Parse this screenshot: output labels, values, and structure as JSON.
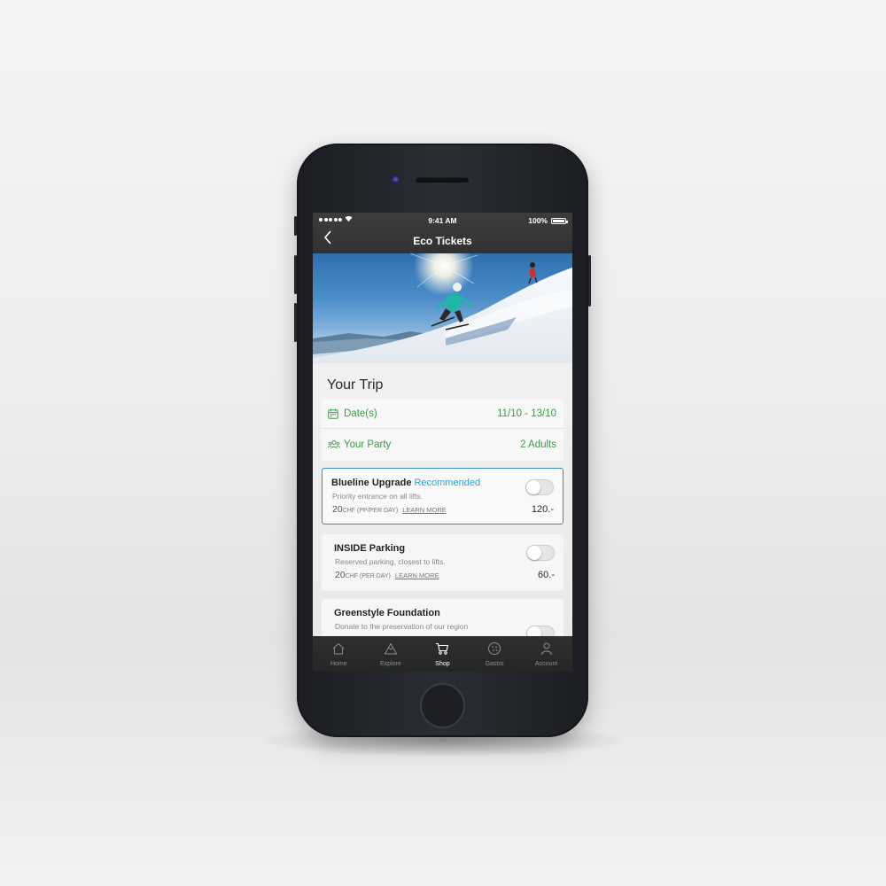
{
  "status_bar": {
    "time": "9:41 AM",
    "battery": "100%"
  },
  "nav": {
    "back_icon": "chevron-left-icon",
    "title": "Eco Tickets"
  },
  "trip": {
    "section_title": "Your Trip",
    "dates_label": "Date(s)",
    "dates_value": "11/10 - 13/10",
    "party_label": "Your Party",
    "party_value": "2 Adults",
    "accent_color": "#3a9b45"
  },
  "options": [
    {
      "title": "Blueline Upgrade",
      "badge": "Recommended",
      "description": "Priority entrance on all lifts.",
      "price": "20",
      "unit": "CHF (PP/PER DAY)",
      "link": "LEARN MORE",
      "amount": "120.-",
      "enabled": false
    },
    {
      "title": "INSIDE Parking",
      "badge": "",
      "description": "Reserved parking, closest to lifts.",
      "price": "20",
      "unit": "CHF (PER DAY)",
      "link": "LEARN MORE",
      "amount": "60.-",
      "enabled": false
    },
    {
      "title": "Greenstyle Foundation",
      "badge": "",
      "description": "Donate to the preservation of our region",
      "price": "",
      "unit": "",
      "link": "",
      "amount": "",
      "enabled": false
    }
  ],
  "tabbar": [
    {
      "label": "Home",
      "icon": "home-icon",
      "active": false
    },
    {
      "label": "Explore",
      "icon": "mountain-icon",
      "active": false
    },
    {
      "label": "Shop",
      "icon": "cart-icon",
      "active": true
    },
    {
      "label": "Gastro",
      "icon": "plate-icon",
      "active": false
    },
    {
      "label": "Account",
      "icon": "user-icon",
      "active": false
    }
  ],
  "colors": {
    "recommended": "#3b9cc4",
    "selected_border": "#3b8fb4"
  }
}
